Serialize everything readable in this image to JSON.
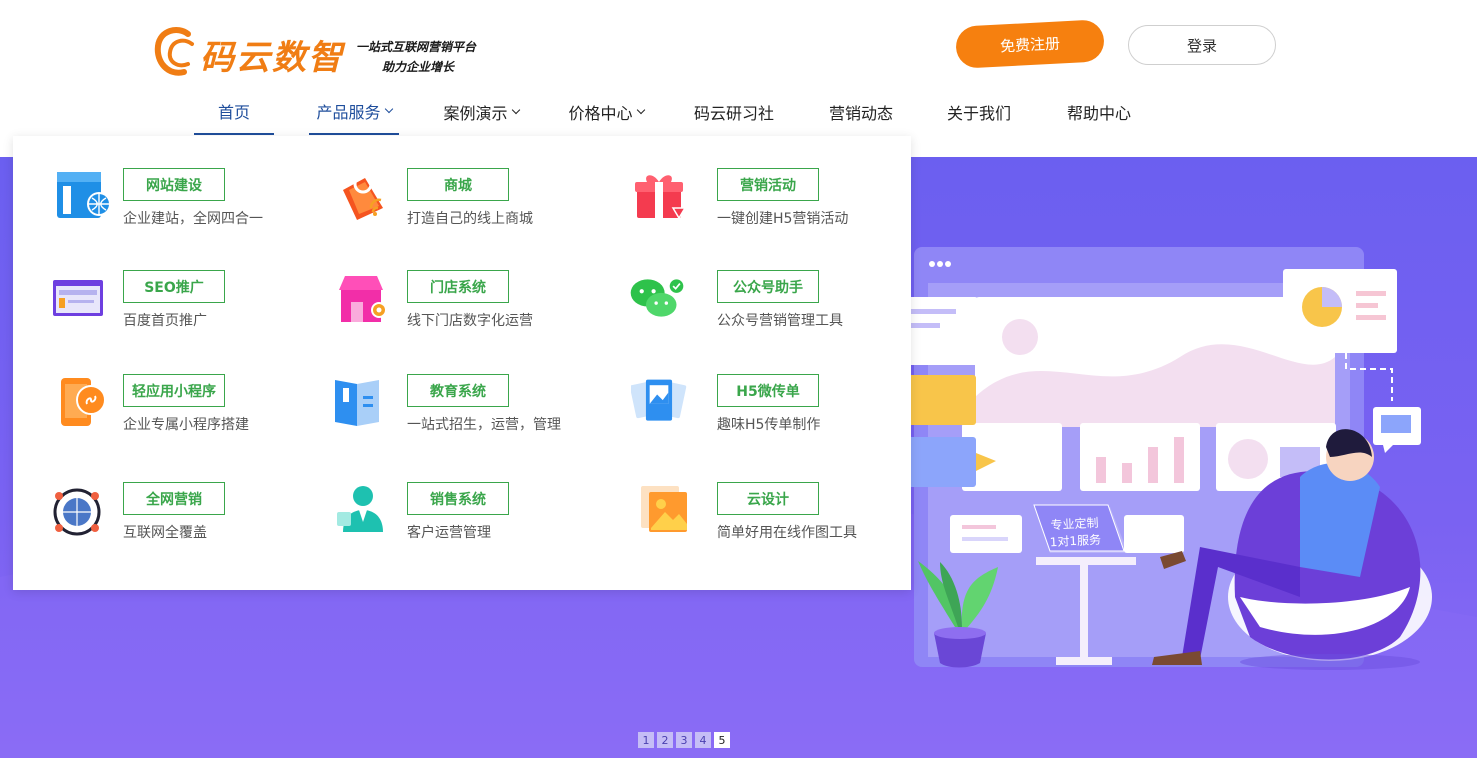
{
  "brand": {
    "name": "码云数智",
    "slogan_line1": "一站式互联网营销平台",
    "slogan_line2": "助力企业增长",
    "accent_color": "#f07d14"
  },
  "header": {
    "register_label": "免费注册",
    "login_label": "登录"
  },
  "nav": {
    "items": [
      {
        "label": "首页"
      },
      {
        "label": "产品服务"
      },
      {
        "label": "案例演示"
      },
      {
        "label": "价格中心"
      },
      {
        "label": "码云研习社"
      },
      {
        "label": "营销动态"
      },
      {
        "label": "关于我们"
      },
      {
        "label": "帮助中心"
      }
    ],
    "active_color": "#1f4e9c"
  },
  "products": [
    {
      "tag": "网站建设",
      "desc": "企业建站，全网四合一",
      "icon": "website-icon"
    },
    {
      "tag": "商城",
      "desc": "打造自己的线上商城",
      "icon": "shopping-bag-icon"
    },
    {
      "tag": "营销活动",
      "desc": "一键创建H5营销活动",
      "icon": "gift-icon"
    },
    {
      "tag": "SEO推广",
      "desc": "百度首页推广",
      "icon": "browser-window-icon"
    },
    {
      "tag": "门店系统",
      "desc": "线下门店数字化运营",
      "icon": "storefront-icon"
    },
    {
      "tag": "公众号助手",
      "desc": "公众号营销管理工具",
      "icon": "wechat-icon"
    },
    {
      "tag": "轻应用小程序",
      "desc": "企业专属小程序搭建",
      "icon": "mini-program-icon"
    },
    {
      "tag": "教育系统",
      "desc": "一站式招生，运营，管理",
      "icon": "book-icon"
    },
    {
      "tag": "H5微传单",
      "desc": "趣味H5传单制作",
      "icon": "flyer-icon"
    },
    {
      "tag": "全网营销",
      "desc": "互联网全覆盖",
      "icon": "network-globe-icon"
    },
    {
      "tag": "销售系统",
      "desc": "客户运营管理",
      "icon": "salesperson-icon"
    },
    {
      "tag": "云设计",
      "desc": "简单好用在线作图工具",
      "icon": "image-design-icon"
    }
  ],
  "banner": {
    "badge_line1": "专业定制",
    "badge_line2": "1对1服务",
    "pages": [
      "1",
      "2",
      "3",
      "4",
      "5"
    ],
    "active_page": "5",
    "bg_color": "#7562f1"
  }
}
